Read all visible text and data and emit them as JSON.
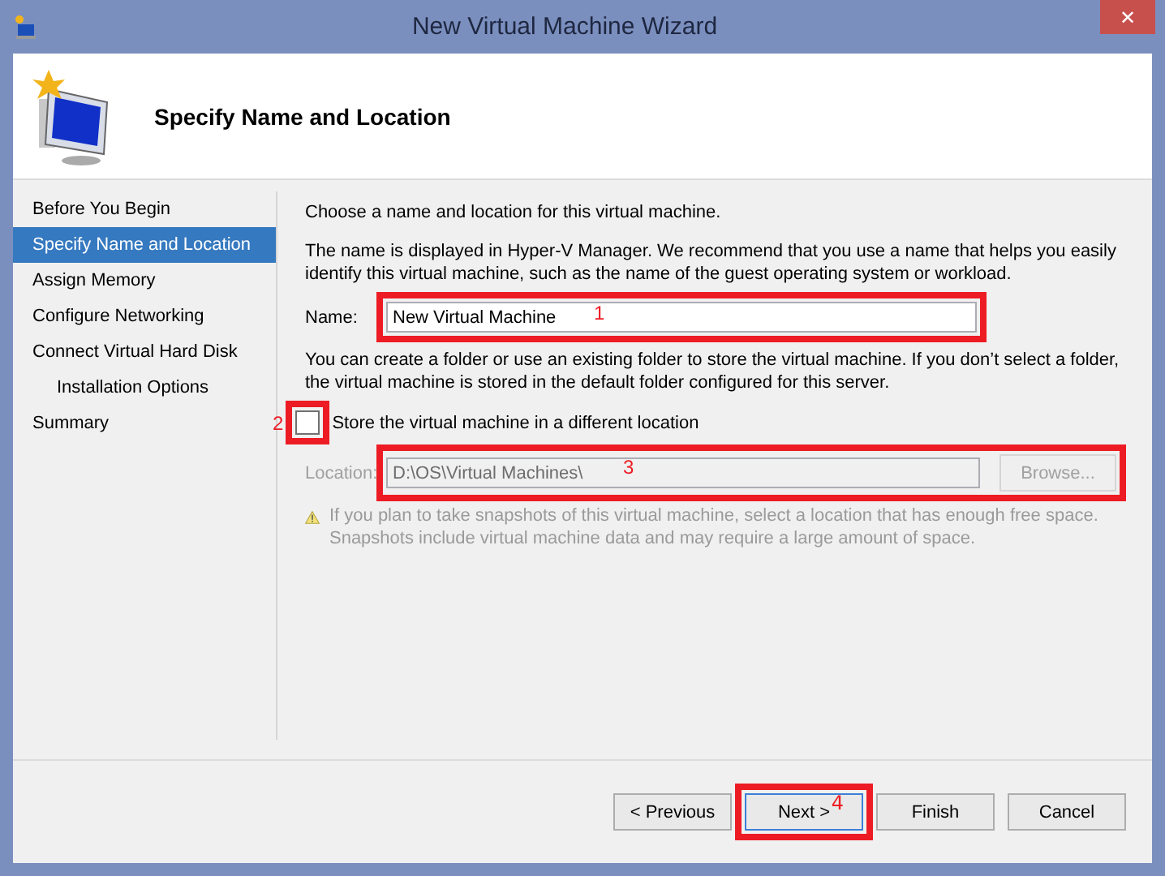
{
  "window": {
    "title": "New Virtual Machine Wizard",
    "close_label": "✕"
  },
  "header": {
    "title": "Specify Name and Location"
  },
  "steps": [
    {
      "label": "Before You Begin",
      "selected": false
    },
    {
      "label": "Specify Name and Location",
      "selected": true
    },
    {
      "label": "Assign Memory",
      "selected": false
    },
    {
      "label": "Configure Networking",
      "selected": false
    },
    {
      "label": "Connect Virtual Hard Disk",
      "selected": false,
      "children": [
        {
          "label": "Installation Options",
          "selected": false
        }
      ]
    },
    {
      "label": "Summary",
      "selected": false
    }
  ],
  "content": {
    "intro": "Choose a name and location for this virtual machine.",
    "description": "The name is displayed in Hyper-V Manager. We recommend that you use a name that helps you easily identify this virtual machine, such as the name of the guest operating system or workload.",
    "name_field": {
      "label": "Name:",
      "value": "New Virtual Machine",
      "annotation": "1"
    },
    "folder_text": "You can create a folder or use an existing folder to store the virtual machine. If you don’t select a folder, the virtual machine is stored in the default folder configured for this server.",
    "store_checkbox": {
      "label": "Store the virtual machine in a different location",
      "checked": false,
      "annotation": "2"
    },
    "location": {
      "label": "Location:",
      "value": "D:\\OS\\Virtual Machines\\",
      "disabled": true,
      "browse_label": "Browse...",
      "annotation": "3"
    },
    "warning": "If you plan to take snapshots of this virtual machine, select a location that has enough free space. Snapshots include virtual machine data and may require a large amount of space."
  },
  "buttons": [
    {
      "label": "< Previous",
      "focused": false
    },
    {
      "label": "Next >",
      "focused": true,
      "annotation": "4"
    },
    {
      "label": "Finish",
      "focused": false
    },
    {
      "label": "Cancel",
      "focused": false
    }
  ]
}
